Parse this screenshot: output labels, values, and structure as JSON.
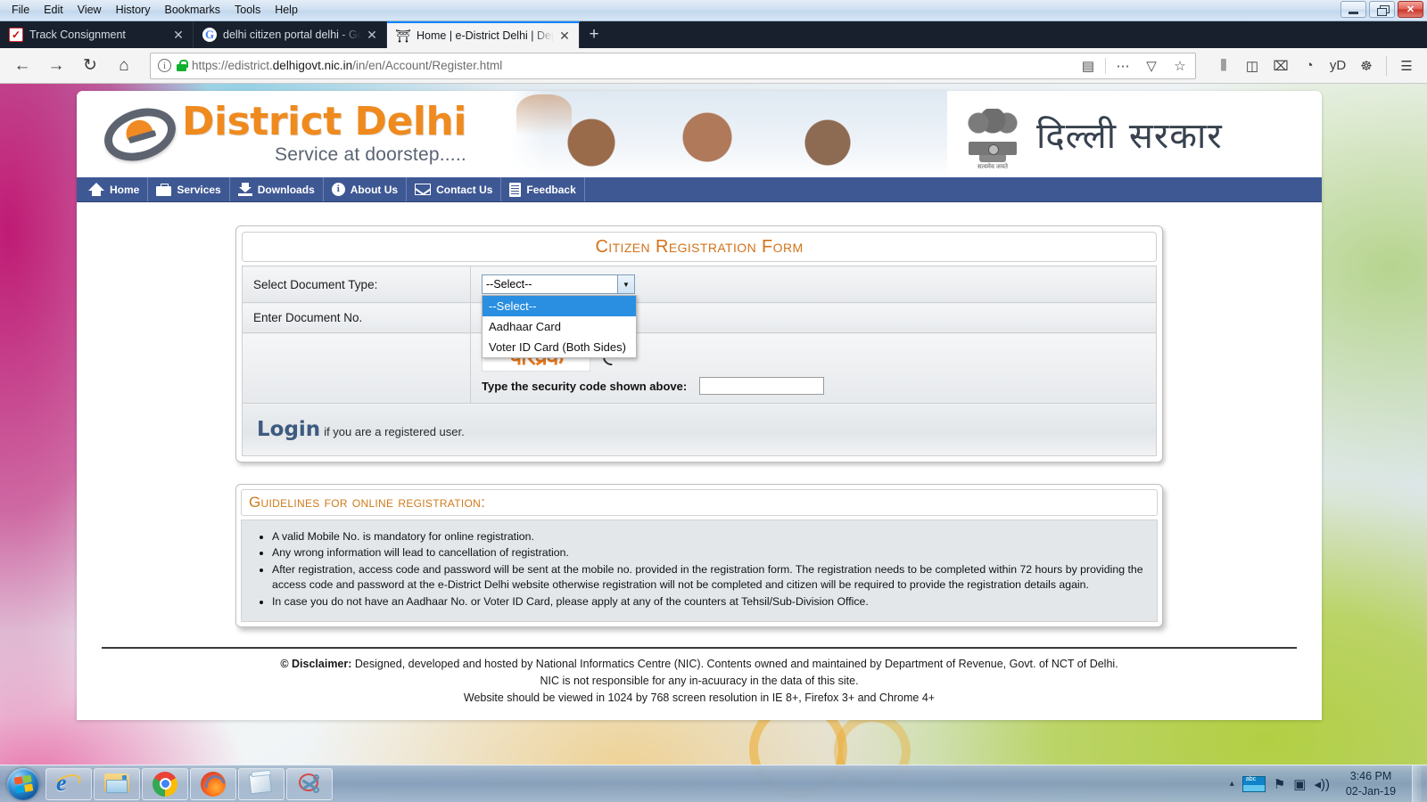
{
  "window": {
    "menubar": [
      "File",
      "Edit",
      "View",
      "History",
      "Bookmarks",
      "Tools",
      "Help"
    ],
    "controls": {
      "minimize": "minimize-button",
      "maximize": "maximize-button",
      "close": "close-button"
    }
  },
  "tabs": [
    {
      "label": "Track Consignment",
      "favicon": "track-consignment-icon",
      "favicon_glyph": "✔",
      "active": false
    },
    {
      "label": "delhi citizen portal delhi - Goog",
      "favicon": "google-icon",
      "favicon_glyph": "G",
      "active": false
    },
    {
      "label": "Home | e-District Delhi | Depart",
      "favicon": "india-emblem-icon",
      "favicon_glyph": "⛩",
      "active": true
    }
  ],
  "newtab_label": "+",
  "toolbar": {
    "back": "←",
    "forward": "→",
    "reload": "↻",
    "home": "⌂",
    "url_prefix": "https://",
    "url_domain_pre": "edistrict.",
    "url_domain_bold": "delhigovt.nic.in",
    "url_path": "/in/en/Account/Register.html",
    "url_full": "https://edistrict.delhigovt.nic.in/in/en/Account/Register.html",
    "reader_icon": "▤",
    "page_actions_icon": "⋯",
    "pocket_icon": "▽",
    "bookmark_icon": "☆",
    "library_icon": "⫼",
    "sidebar_icon": "◫",
    "screenshot_icon": "⌧",
    "chat_icon": "◔",
    "yd_icon": "yD",
    "lifebuoy_icon": "☸",
    "menu_icon": "☰"
  },
  "site": {
    "brand_title": "District Delhi",
    "brand_tagline": "Service at doorstep.....",
    "govt_hindi": "दिल्ली सरकार",
    "emblem_motto": "सत्यमेव जयते",
    "nav": [
      {
        "label": "Home",
        "icon": "home-icon"
      },
      {
        "label": "Services",
        "icon": "briefcase-icon"
      },
      {
        "label": "Downloads",
        "icon": "download-icon"
      },
      {
        "label": "About Us",
        "icon": "info-icon"
      },
      {
        "label": "Contact Us",
        "icon": "mail-icon"
      },
      {
        "label": "Feedback",
        "icon": "document-icon"
      }
    ]
  },
  "form": {
    "title": "Citizen Registration Form",
    "doc_type_label": "Select Document Type:",
    "doc_type_value": "--Select--",
    "doc_no_label": "Enter Document No.",
    "dropdown_open": true,
    "dropdown_options": [
      {
        "label": "--Select--",
        "selected": true
      },
      {
        "label": "Aadhaar Card",
        "selected": false
      },
      {
        "label": "Voter ID Card (Both Sides)",
        "selected": false
      }
    ],
    "captcha_text": "परिव्रक",
    "captcha_refresh_icon": "refresh-icon",
    "captcha_label": "Type the security code shown above:",
    "captcha_input_value": "",
    "login_link": "Login",
    "login_note": "if you are a registered user."
  },
  "guidelines": {
    "title": "Guidelines for online registration:",
    "items": [
      "A valid Mobile No. is mandatory for online registration.",
      "Any wrong information will lead to cancellation of registration.",
      "After registration, access code and password will be sent at the mobile no. provided in the registration form. The registration needs to be completed within 72 hours by providing the access code and password at the e-District Delhi website otherwise registration will not be completed and citizen will be required to provide the registration details again.",
      "In case you do not have an Aadhaar No. or Voter ID Card, please apply at any of the counters at Tehsil/Sub-Division Office."
    ]
  },
  "footer": {
    "line1_bold": "© Disclaimer:",
    "line1": " Designed, developed and hosted by National Informatics Centre (NIC). Contents owned and maintained by Department of Revenue, Govt. of NCT of Delhi.",
    "line2": "NIC is not responsible for any in-acuuracy in the data of this site.",
    "line3": "Website should be viewed in 1024 by 768 screen resolution in IE 8+, Firefox 3+ and Chrome 4+"
  },
  "taskbar": {
    "start_label": "start-button",
    "items": [
      {
        "name": "internet-explorer",
        "icon": "internet-explorer-icon"
      },
      {
        "name": "file-explorer",
        "icon": "file-explorer-icon"
      },
      {
        "name": "google-chrome",
        "icon": "chrome-icon"
      },
      {
        "name": "mozilla-firefox",
        "icon": "firefox-icon"
      },
      {
        "name": "notepad",
        "icon": "notepad-icon"
      },
      {
        "name": "snipping-tool",
        "icon": "snipping-tool-icon"
      }
    ],
    "tray": {
      "chevron": "▴",
      "language_icon": "language-bar-icon",
      "flag_icon": "⚑",
      "network_icon": "▣",
      "volume_icon": "◂))",
      "time": "3:46 PM",
      "date": "02-Jan-19"
    }
  },
  "colors": {
    "brand_orange": "#ef8a1f",
    "nav_blue": "#3e5894",
    "highlight_blue": "#2a8fe0",
    "title_orange": "#d2731a"
  }
}
